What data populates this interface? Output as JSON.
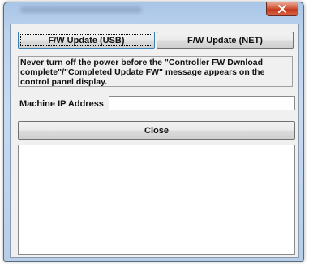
{
  "window": {
    "close_label": "Close window"
  },
  "buttons": {
    "usb_label": "F/W Update (USB)",
    "net_label": "F/W Update (NET)",
    "close_label": "Close"
  },
  "notice": {
    "text": "Never turn off the power before the \"Controller FW Dwnload complete\"/\"Completed Update FW\" message appears on the control panel display."
  },
  "ip_field": {
    "label": "Machine IP Address",
    "value": ""
  },
  "log_area": {
    "value": ""
  }
}
